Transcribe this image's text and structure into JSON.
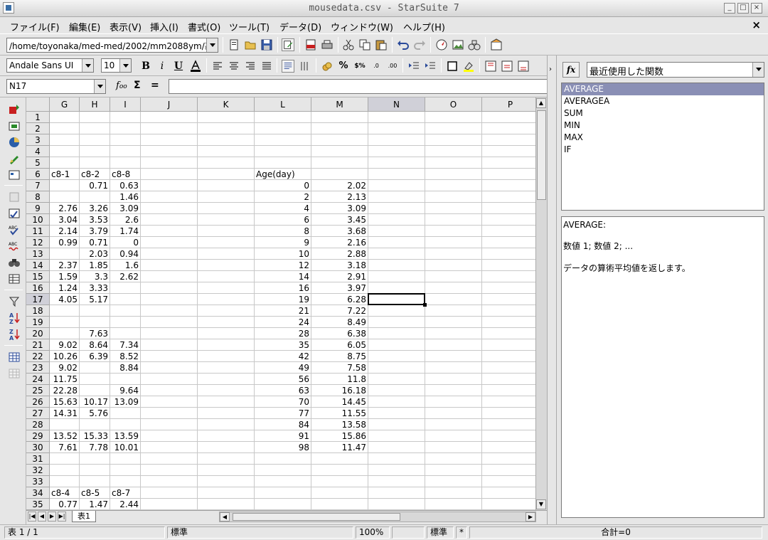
{
  "window": {
    "title": "mousedata.csv - StarSuite 7"
  },
  "menu": [
    "ファイル(F)",
    "編集(E)",
    "表示(V)",
    "挿入(I)",
    "書式(O)",
    "ツール(T)",
    "データ(D)",
    "ウィンドウ(W)",
    "ヘルプ(H)"
  ],
  "toolbar": {
    "path": "/home/toyonaka/med-med/2002/mm2088ym/基"
  },
  "format": {
    "font_name": "Andale Sans UI",
    "font_size": "10",
    "bold": "B",
    "italic": "i",
    "underline": "U"
  },
  "formula": {
    "cell_ref": "N17",
    "value": ""
  },
  "sheet": {
    "columns": [
      "G",
      "H",
      "I",
      "J",
      "K",
      "L",
      "M",
      "N",
      "O",
      "P"
    ],
    "selected_column": "N",
    "selected_row": "17",
    "rows": [
      {
        "n": "1",
        "G": "",
        "H": "",
        "I": "",
        "L": "",
        "M": ""
      },
      {
        "n": "2",
        "G": "",
        "H": "",
        "I": "",
        "L": "",
        "M": ""
      },
      {
        "n": "3",
        "G": "",
        "H": "",
        "I": "",
        "L": "",
        "M": ""
      },
      {
        "n": "4",
        "G": "",
        "H": "",
        "I": "",
        "L": "",
        "M": ""
      },
      {
        "n": "5",
        "G": "",
        "H": "",
        "I": "",
        "L": "",
        "M": ""
      },
      {
        "n": "6",
        "G": "c8-1",
        "H": "c8-2",
        "I": "c8-8",
        "L": "Age(day)",
        "M": ""
      },
      {
        "n": "7",
        "G": "",
        "H": "0.71",
        "I": "0.63",
        "L": "0",
        "M": "2.02"
      },
      {
        "n": "8",
        "G": "",
        "H": "",
        "I": "1.46",
        "L": "2",
        "M": "2.13"
      },
      {
        "n": "9",
        "G": "2.76",
        "H": "3.26",
        "I": "3.09",
        "L": "4",
        "M": "3.09"
      },
      {
        "n": "10",
        "G": "3.04",
        "H": "3.53",
        "I": "2.6",
        "L": "6",
        "M": "3.45"
      },
      {
        "n": "11",
        "G": "2.14",
        "H": "3.79",
        "I": "1.74",
        "L": "8",
        "M": "3.68"
      },
      {
        "n": "12",
        "G": "0.99",
        "H": "0.71",
        "I": "0",
        "L": "9",
        "M": "2.16"
      },
      {
        "n": "13",
        "G": "",
        "H": "2.03",
        "I": "0.94",
        "L": "10",
        "M": "2.88"
      },
      {
        "n": "14",
        "G": "2.37",
        "H": "1.85",
        "I": "1.6",
        "L": "12",
        "M": "3.18"
      },
      {
        "n": "15",
        "G": "1.59",
        "H": "3.3",
        "I": "2.62",
        "L": "14",
        "M": "2.91"
      },
      {
        "n": "16",
        "G": "1.24",
        "H": "3.33",
        "I": "",
        "L": "16",
        "M": "3.97"
      },
      {
        "n": "17",
        "G": "4.05",
        "H": "5.17",
        "I": "",
        "L": "19",
        "M": "6.28"
      },
      {
        "n": "18",
        "G": "",
        "H": "",
        "I": "",
        "L": "21",
        "M": "7.22"
      },
      {
        "n": "19",
        "G": "",
        "H": "",
        "I": "",
        "L": "24",
        "M": "8.49"
      },
      {
        "n": "20",
        "G": "",
        "H": "7.63",
        "I": "",
        "L": "28",
        "M": "6.38"
      },
      {
        "n": "21",
        "G": "9.02",
        "H": "8.64",
        "I": "7.34",
        "L": "35",
        "M": "6.05"
      },
      {
        "n": "22",
        "G": "10.26",
        "H": "6.39",
        "I": "8.52",
        "L": "42",
        "M": "8.75"
      },
      {
        "n": "23",
        "G": "9.02",
        "H": "",
        "I": "8.84",
        "L": "49",
        "M": "7.58"
      },
      {
        "n": "24",
        "G": "11.75",
        "H": "",
        "I": "",
        "L": "56",
        "M": "11.8"
      },
      {
        "n": "25",
        "G": "22.28",
        "H": "",
        "I": "9.64",
        "L": "63",
        "M": "16.18"
      },
      {
        "n": "26",
        "G": "15.63",
        "H": "10.17",
        "I": "13.09",
        "L": "70",
        "M": "14.45"
      },
      {
        "n": "27",
        "G": "14.31",
        "H": "5.76",
        "I": "",
        "L": "77",
        "M": "11.55"
      },
      {
        "n": "28",
        "G": "",
        "H": "",
        "I": "",
        "L": "84",
        "M": "13.58"
      },
      {
        "n": "29",
        "G": "13.52",
        "H": "15.33",
        "I": "13.59",
        "L": "91",
        "M": "15.86"
      },
      {
        "n": "30",
        "G": "7.61",
        "H": "7.78",
        "I": "10.01",
        "L": "98",
        "M": "11.47"
      },
      {
        "n": "31",
        "G": "",
        "H": "",
        "I": "",
        "L": "",
        "M": ""
      },
      {
        "n": "32",
        "G": "",
        "H": "",
        "I": "",
        "L": "",
        "M": ""
      },
      {
        "n": "33",
        "G": "",
        "H": "",
        "I": "",
        "L": "",
        "M": ""
      },
      {
        "n": "34",
        "G": "c8-4",
        "H": "c8-5",
        "I": "c8-7",
        "L": "",
        "M": ""
      },
      {
        "n": "35",
        "G": "0.77",
        "H": "1.47",
        "I": "2.44",
        "L": "",
        "M": ""
      }
    ],
    "text_cells": [
      "c8-1",
      "c8-2",
      "c8-8",
      "Age(day)",
      "c8-4",
      "c8-5",
      "c8-7"
    ]
  },
  "tabs": {
    "sheet_tab": "表1"
  },
  "status": {
    "sheet_pos": "表 1 / 1",
    "style": "標準",
    "zoom": "100%",
    "mode": "標準",
    "modified": "*",
    "sum": "合計=0"
  },
  "functions": {
    "category": "最近使用した関数",
    "items": [
      "AVERAGE",
      "AVERAGEA",
      "SUM",
      "MIN",
      "MAX",
      "IF"
    ],
    "selected": "AVERAGE",
    "desc_name": "AVERAGE:",
    "desc_args": "数値 1; 数値 2; ...",
    "desc_text": "データの算術平均値を返します。"
  }
}
